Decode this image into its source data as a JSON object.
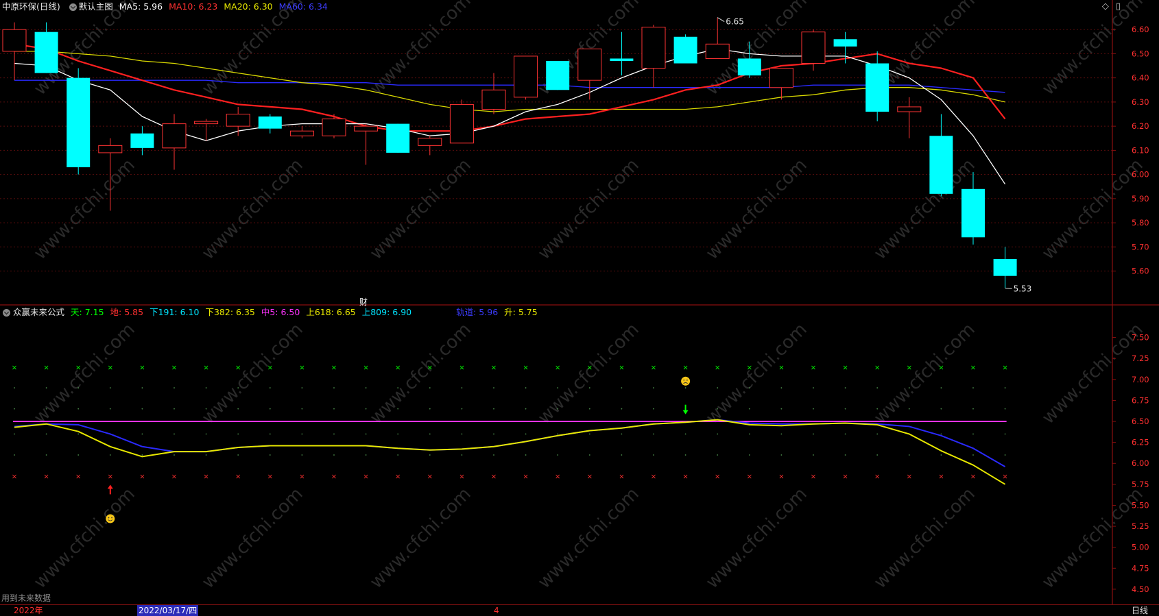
{
  "header": {
    "stock": "中原环保(日线)",
    "main_chart_name": "默认主图",
    "ma": [
      {
        "label": "MA5: 5.96",
        "color": "#ffffff"
      },
      {
        "label": "MA10: 6.23",
        "color": "#ff3030"
      },
      {
        "label": "MA20: 6.30",
        "color": "#e8e800"
      },
      {
        "label": "MA60: 6.34",
        "color": "#3c3cff"
      }
    ],
    "icons": [
      "diamond-icon",
      "maximize-icon"
    ]
  },
  "indicator_header": {
    "name": "众赢未来公式",
    "items": [
      {
        "label": "天: 7.15",
        "color": "#00ff00"
      },
      {
        "label": "地: 5.85",
        "color": "#ff3030"
      },
      {
        "label": "下191: 6.10",
        "color": "#00e5ff"
      },
      {
        "label": "下382: 6.35",
        "color": "#e8e800"
      },
      {
        "label": "中5: 6.50",
        "color": "#ff33ff"
      },
      {
        "label": "上618: 6.65",
        "color": "#e8e800"
      },
      {
        "label": "上809: 6.90",
        "color": "#00e5ff"
      },
      {
        "label": "轨道: 5.96",
        "color": "#3c3cff"
      },
      {
        "label": "升: 5.75",
        "color": "#e8e800"
      }
    ]
  },
  "finance_marker": "财",
  "footer": {
    "note": "用到未来数据",
    "year": "2022年",
    "date": "2022/03/17/四",
    "month_mark": "4",
    "period": "日线"
  },
  "chart_data": [
    {
      "type": "candlestick",
      "title": "中原环保(日线)",
      "ylim": [
        5.46,
        6.66
      ],
      "y_ticks": [
        5.6,
        5.7,
        5.8,
        5.9,
        6.0,
        6.1,
        6.2,
        6.3,
        6.4,
        6.5,
        6.6
      ],
      "annotations": [
        {
          "label": "6.65",
          "index": 22,
          "value": 6.65
        },
        {
          "label": "5.53",
          "index": 31,
          "value": 5.53
        }
      ],
      "candles": [
        {
          "o": 6.51,
          "c": 6.6,
          "h": 6.63,
          "l": 6.39
        },
        {
          "o": 6.59,
          "c": 6.42,
          "h": 6.63,
          "l": 6.42
        },
        {
          "o": 6.4,
          "c": 6.03,
          "h": 6.44,
          "l": 6.0
        },
        {
          "o": 6.09,
          "c": 6.12,
          "h": 6.15,
          "l": 5.85
        },
        {
          "o": 6.17,
          "c": 6.11,
          "h": 6.2,
          "l": 6.08
        },
        {
          "o": 6.11,
          "c": 6.21,
          "h": 6.25,
          "l": 6.02
        },
        {
          "o": 6.21,
          "c": 6.22,
          "h": 6.23,
          "l": 6.14
        },
        {
          "o": 6.2,
          "c": 6.25,
          "h": 6.28,
          "l": 6.16
        },
        {
          "o": 6.24,
          "c": 6.19,
          "h": 6.25,
          "l": 6.17
        },
        {
          "o": 6.16,
          "c": 6.18,
          "h": 6.2,
          "l": 6.15
        },
        {
          "o": 6.16,
          "c": 6.23,
          "h": 6.25,
          "l": 6.15
        },
        {
          "o": 6.18,
          "c": 6.2,
          "h": 6.21,
          "l": 6.04
        },
        {
          "o": 6.21,
          "c": 6.09,
          "h": 6.21,
          "l": 6.09
        },
        {
          "o": 6.12,
          "c": 6.15,
          "h": 6.16,
          "l": 6.08
        },
        {
          "o": 6.13,
          "c": 6.29,
          "h": 6.31,
          "l": 6.13
        },
        {
          "o": 6.27,
          "c": 6.35,
          "h": 6.42,
          "l": 6.25
        },
        {
          "o": 6.32,
          "c": 6.49,
          "h": 6.49,
          "l": 6.31
        },
        {
          "o": 6.47,
          "c": 6.35,
          "h": 6.47,
          "l": 6.35
        },
        {
          "o": 6.39,
          "c": 6.52,
          "h": 6.52,
          "l": 6.31
        },
        {
          "o": 6.48,
          "c": 6.47,
          "h": 6.59,
          "l": 6.41
        },
        {
          "o": 6.44,
          "c": 6.61,
          "h": 6.62,
          "l": 6.36
        },
        {
          "o": 6.57,
          "c": 6.46,
          "h": 6.58,
          "l": 6.46
        },
        {
          "o": 6.48,
          "c": 6.54,
          "h": 6.65,
          "l": 6.48
        },
        {
          "o": 6.48,
          "c": 6.41,
          "h": 6.55,
          "l": 6.4
        },
        {
          "o": 6.36,
          "c": 6.44,
          "h": 6.44,
          "l": 6.31
        },
        {
          "o": 6.46,
          "c": 6.59,
          "h": 6.6,
          "l": 6.43
        },
        {
          "o": 6.56,
          "c": 6.53,
          "h": 6.59,
          "l": 6.46
        },
        {
          "o": 6.46,
          "c": 6.26,
          "h": 6.51,
          "l": 6.22
        },
        {
          "o": 6.26,
          "c": 6.28,
          "h": 6.32,
          "l": 6.15
        },
        {
          "o": 6.16,
          "c": 5.92,
          "h": 6.25,
          "l": 5.91
        },
        {
          "o": 5.94,
          "c": 5.74,
          "h": 6.01,
          "l": 5.71
        },
        {
          "o": 5.65,
          "c": 5.58,
          "h": 5.7,
          "l": 5.53
        }
      ],
      "series": [
        {
          "name": "MA5",
          "color": "#ffffff",
          "values": [
            6.46,
            6.45,
            6.39,
            6.35,
            6.24,
            6.18,
            6.14,
            6.18,
            6.2,
            6.21,
            6.21,
            6.21,
            6.19,
            6.16,
            6.17,
            6.2,
            6.26,
            6.29,
            6.34,
            6.4,
            6.45,
            6.49,
            6.52,
            6.5,
            6.49,
            6.49,
            6.49,
            6.45,
            6.4,
            6.31,
            6.16,
            5.96
          ]
        },
        {
          "name": "MA10",
          "color": "#ff2020",
          "values": [
            6.54,
            6.52,
            6.47,
            6.43,
            6.39,
            6.35,
            6.32,
            6.29,
            6.28,
            6.27,
            6.24,
            6.2,
            6.18,
            6.18,
            6.18,
            6.2,
            6.23,
            6.24,
            6.25,
            6.28,
            6.31,
            6.35,
            6.37,
            6.42,
            6.45,
            6.46,
            6.48,
            6.5,
            6.46,
            6.44,
            6.4,
            6.23
          ]
        },
        {
          "name": "MA20",
          "color": "#d8d800",
          "values": [
            6.51,
            6.51,
            6.5,
            6.49,
            6.47,
            6.46,
            6.44,
            6.42,
            6.4,
            6.38,
            6.37,
            6.35,
            6.32,
            6.29,
            6.27,
            6.26,
            6.27,
            6.27,
            6.27,
            6.27,
            6.27,
            6.27,
            6.28,
            6.3,
            6.32,
            6.33,
            6.35,
            6.36,
            6.36,
            6.35,
            6.33,
            6.3
          ]
        },
        {
          "name": "MA60",
          "color": "#2a2aff",
          "values": [
            6.39,
            6.39,
            6.39,
            6.39,
            6.39,
            6.39,
            6.39,
            6.38,
            6.38,
            6.38,
            6.38,
            6.38,
            6.37,
            6.37,
            6.37,
            6.37,
            6.37,
            6.37,
            6.36,
            6.36,
            6.36,
            6.36,
            6.36,
            6.36,
            6.36,
            6.37,
            6.37,
            6.37,
            6.37,
            6.36,
            6.35,
            6.34
          ]
        }
      ]
    },
    {
      "type": "line",
      "title": "众赢未来公式",
      "ylim": [
        4.45,
        7.75
      ],
      "y_ticks": [
        4.5,
        4.75,
        5.0,
        5.25,
        5.5,
        5.75,
        6.0,
        6.25,
        6.5,
        6.75,
        7.0,
        7.25,
        7.5
      ],
      "levels": [
        {
          "name": "天",
          "value": 7.15,
          "color": "#00ff00",
          "style": "x"
        },
        {
          "name": "上809",
          "value": 6.9,
          "color": "#4a8a4a",
          "style": "dot"
        },
        {
          "name": "上618",
          "value": 6.65,
          "color": "#4a8a4a",
          "style": "dot"
        },
        {
          "name": "中5",
          "value": 6.5,
          "color": "#ff33ff",
          "style": "line"
        },
        {
          "name": "下382",
          "value": 6.35,
          "color": "#4a8a4a",
          "style": "dot"
        },
        {
          "name": "下191",
          "value": 6.1,
          "color": "#4a8a4a",
          "style": "dot"
        },
        {
          "name": "地",
          "value": 5.85,
          "color": "#ff3030",
          "style": "x"
        }
      ],
      "series": [
        {
          "name": "轨道",
          "color": "#2a2aff",
          "values": [
            6.44,
            6.47,
            6.46,
            6.35,
            6.2,
            6.14,
            6.14,
            6.19,
            6.21,
            6.21,
            6.21,
            6.21,
            6.18,
            6.16,
            6.17,
            6.2,
            6.26,
            6.33,
            6.39,
            6.42,
            6.47,
            6.49,
            6.52,
            6.48,
            6.47,
            6.47,
            6.48,
            6.47,
            6.44,
            6.33,
            6.18,
            5.96
          ]
        },
        {
          "name": "升",
          "color": "#e8e800",
          "values": [
            6.43,
            6.47,
            6.38,
            6.2,
            6.08,
            6.14,
            6.14,
            6.19,
            6.21,
            6.21,
            6.21,
            6.21,
            6.18,
            6.16,
            6.17,
            6.2,
            6.26,
            6.33,
            6.39,
            6.42,
            6.47,
            6.49,
            6.52,
            6.46,
            6.45,
            6.47,
            6.48,
            6.46,
            6.35,
            6.15,
            5.98,
            5.75
          ]
        }
      ],
      "signals": [
        {
          "type": "buy-arrow",
          "index": 3,
          "value": 5.68,
          "color": "#ff2020"
        },
        {
          "type": "smile",
          "index": 3,
          "value": 5.34
        },
        {
          "type": "sell-arrow",
          "index": 21,
          "value": 6.65,
          "color": "#00ff00"
        },
        {
          "type": "frown",
          "index": 21,
          "value": 6.98
        }
      ]
    }
  ]
}
